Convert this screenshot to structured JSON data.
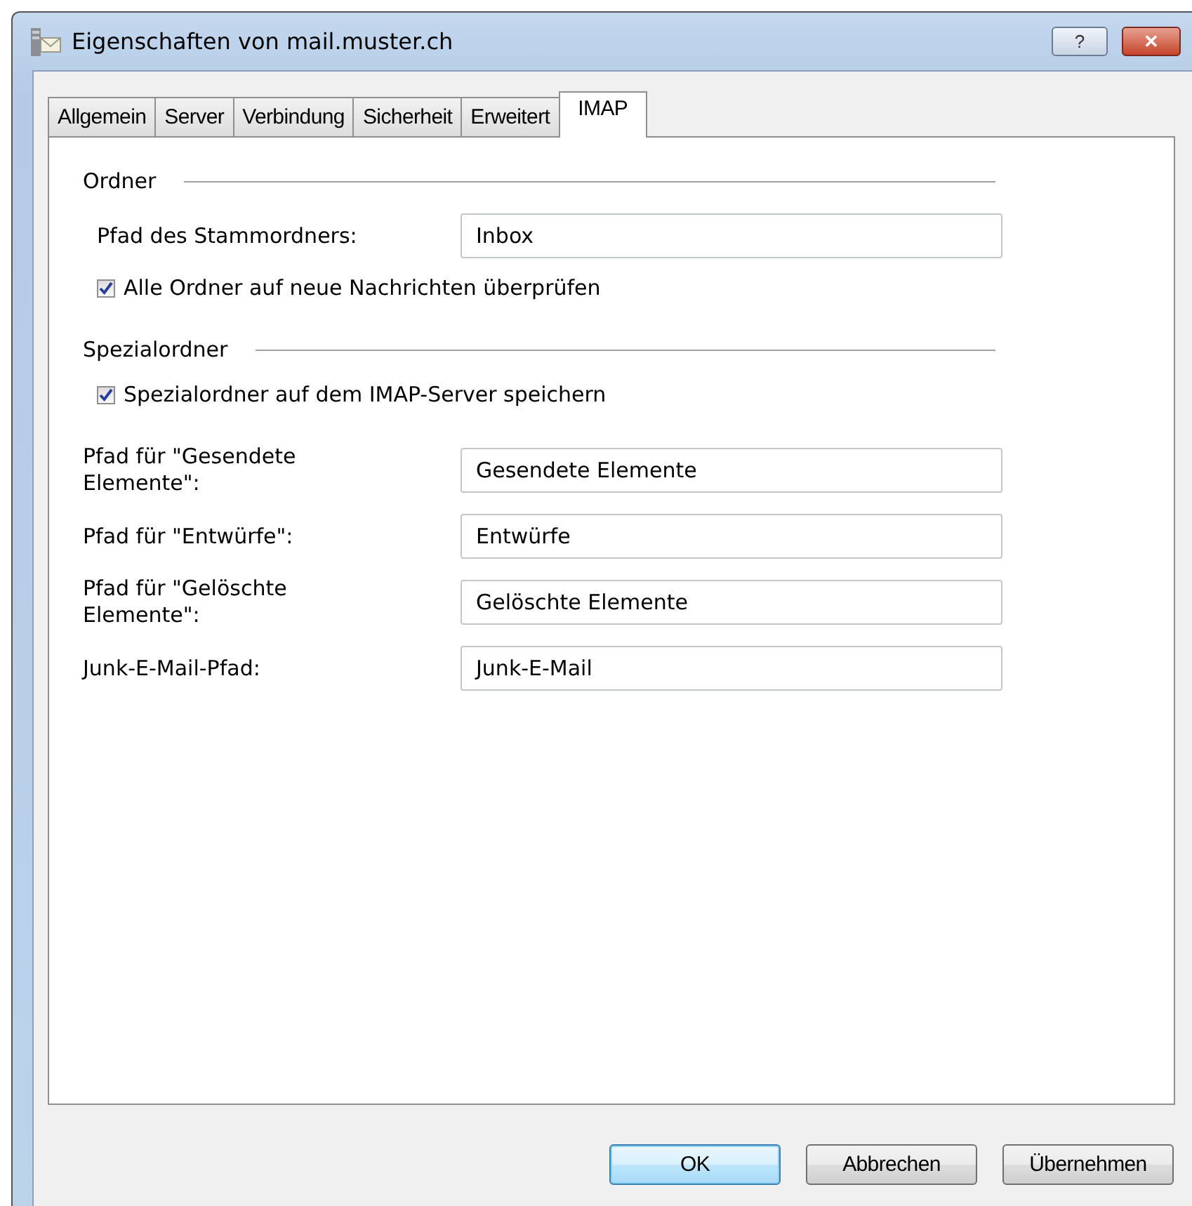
{
  "window": {
    "title": "Eigenschaften von mail.muster.ch",
    "help": "?",
    "close": "✕"
  },
  "tabs": [
    {
      "label": "Allgemein",
      "selected": false
    },
    {
      "label": "Server",
      "selected": false
    },
    {
      "label": "Verbindung",
      "selected": false
    },
    {
      "label": "Sicherheit",
      "selected": false
    },
    {
      "label": "Erweitert",
      "selected": false
    },
    {
      "label": "IMAP",
      "selected": true
    }
  ],
  "sections": [
    {
      "title": "Ordner",
      "items": [
        {
          "kind": "field",
          "label": "Pfad des Stammordners:",
          "value": "Inbox"
        },
        {
          "kind": "checkbox",
          "label": "Alle Ordner auf neue Nachrichten überprüfen",
          "checked": true
        }
      ]
    },
    {
      "title": "Spezialordner",
      "items": [
        {
          "kind": "checkbox",
          "label": "Spezialordner auf dem IMAP-Server speichern",
          "checked": true
        },
        {
          "kind": "field",
          "label": "Pfad für \"Gesendete Elemente\":",
          "value": "Gesendete Elemente"
        },
        {
          "kind": "field",
          "label": "Pfad für \"Entwürfe\":",
          "value": "Entwürfe"
        },
        {
          "kind": "field",
          "label": "Pfad für \"Gelöschte Elemente\":",
          "value": "Gelöschte Elemente"
        },
        {
          "kind": "field",
          "label": "Junk-E-Mail-Pfad:",
          "value": "Junk-E-Mail"
        }
      ]
    }
  ],
  "buttons": [
    {
      "label": "OK",
      "default": true
    },
    {
      "label": "Abbrechen",
      "default": false
    },
    {
      "label": "Übernehmen",
      "default": false
    }
  ]
}
